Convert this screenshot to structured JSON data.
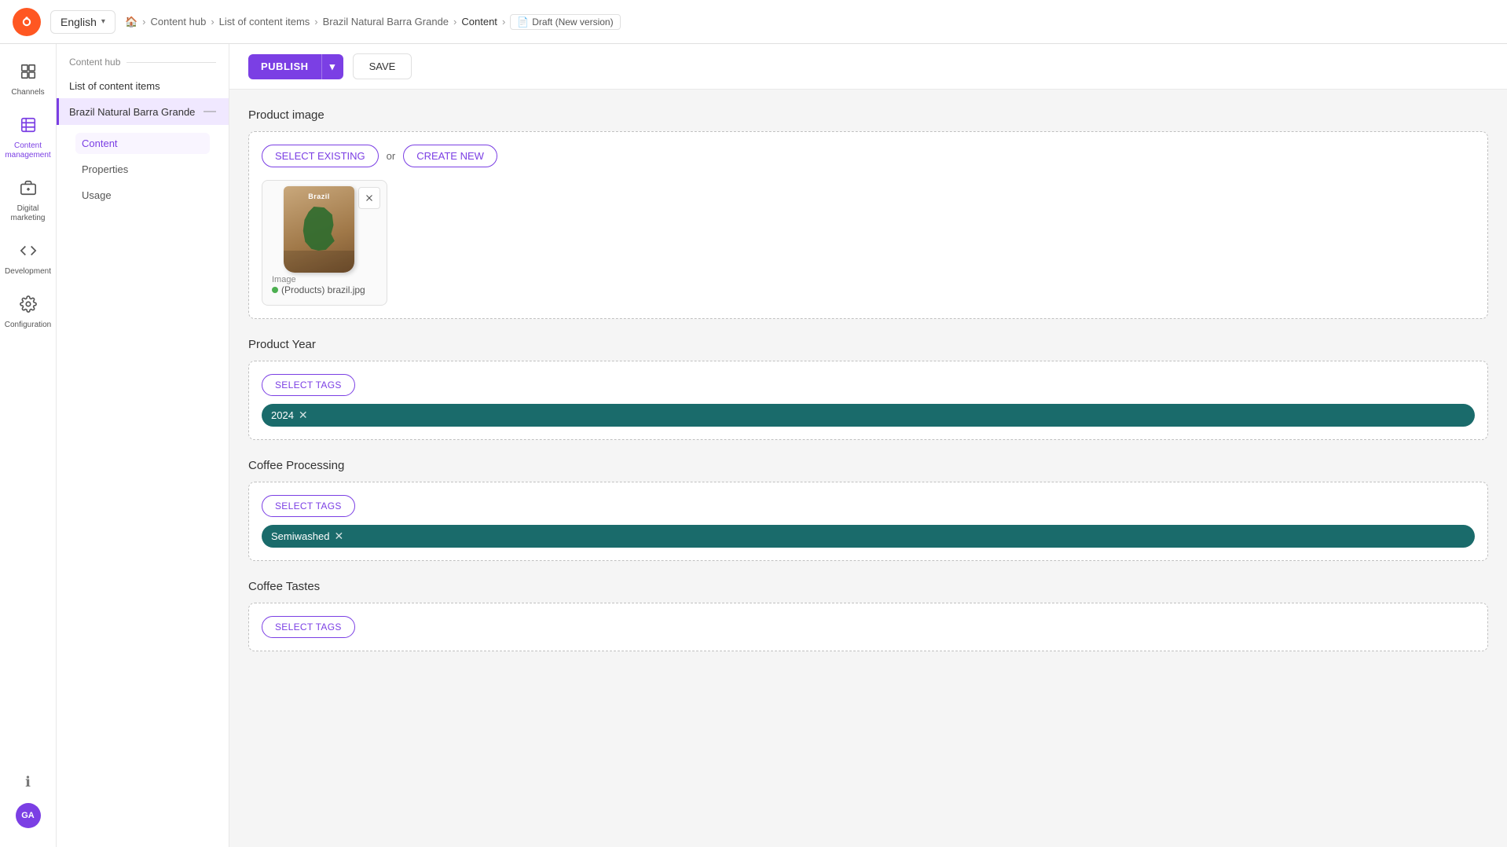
{
  "app": {
    "logo_alt": "Sitecore logo"
  },
  "topnav": {
    "language": "English",
    "breadcrumb": {
      "home": "Home",
      "content_hub": "Content hub",
      "list": "List of content items",
      "item": "Brazil Natural Barra Grande",
      "section": "Content",
      "draft": "Draft (New version)"
    }
  },
  "sidebar": {
    "items": [
      {
        "id": "channels",
        "label": "Channels",
        "icon": "⊞"
      },
      {
        "id": "content-management",
        "label": "Content management",
        "icon": "📋",
        "active": true
      },
      {
        "id": "digital-marketing",
        "label": "Digital marketing",
        "icon": "🏪"
      },
      {
        "id": "development",
        "label": "Development",
        "icon": "</>"
      },
      {
        "id": "configuration",
        "label": "Configuration",
        "icon": "⚙"
      }
    ],
    "bottom": {
      "info": "ℹ",
      "avatar": "GA"
    }
  },
  "left_panel": {
    "section_title": "Content hub",
    "list_title": "List of content items",
    "selected_item": "Brazil Natural Barra Grande",
    "nav_items": [
      {
        "id": "content",
        "label": "Content",
        "active": true
      },
      {
        "id": "properties",
        "label": "Properties"
      },
      {
        "id": "usage",
        "label": "Usage"
      }
    ]
  },
  "toolbar": {
    "publish_label": "PUBLISH",
    "save_label": "SAVE"
  },
  "main": {
    "product_image_section": {
      "title": "Product image",
      "select_existing_label": "SELECT EXISTING",
      "or_text": "or",
      "create_new_label": "CREATE NEW",
      "image_label": "Image",
      "image_file": "(Products) brazil.jpg"
    },
    "product_year_section": {
      "title": "Product Year",
      "select_tags_label": "SELECT TAGS",
      "tags": [
        "2024"
      ]
    },
    "coffee_processing_section": {
      "title": "Coffee Processing",
      "select_tags_label": "SELECT TAGS",
      "tags": [
        "Semiwashed"
      ]
    },
    "coffee_tastes_section": {
      "title": "Coffee Tastes",
      "select_tags_label": "SELECT TAGS",
      "tags": []
    }
  },
  "colors": {
    "accent": "#7b3fe4",
    "teal": "#1a6b6b",
    "green": "#4caf50"
  }
}
